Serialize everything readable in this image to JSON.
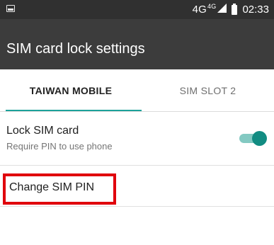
{
  "status_bar": {
    "notification_icon": "screenshot-notification-icon",
    "network": "4G",
    "network_sup": "4G",
    "signal_icon": "cellular-signal-icon",
    "battery_icon": "battery-icon",
    "time": "02:33"
  },
  "app_bar": {
    "title": "SIM card lock settings"
  },
  "tabs": [
    {
      "label": "TAIWAN MOBILE",
      "selected": true
    },
    {
      "label": "SIM SLOT 2",
      "selected": false
    }
  ],
  "settings": {
    "lock_sim": {
      "title": "Lock SIM card",
      "subtitle": "Require PIN to use phone",
      "enabled": true
    },
    "change_pin": {
      "title": "Change SIM PIN"
    }
  },
  "colors": {
    "accent": "#1ea29a",
    "toggle_thumb": "#128c82",
    "toggle_track": "#83c9c2",
    "highlight": "#e0000c",
    "app_bar": "#3c3c3c",
    "status_bar": "#303030"
  }
}
